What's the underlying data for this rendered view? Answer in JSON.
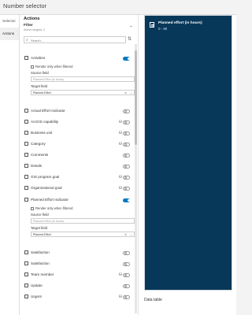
{
  "app_title": "Number selector",
  "left_tabs": [
    "Selector",
    "Actions"
  ],
  "settings": {
    "header": "Actions",
    "filter_title": "Filter",
    "filter_subtitle": "Active targets: 2",
    "search_placeholder": "Search..."
  },
  "fields": [
    {
      "label": "Activities",
      "icon": "table-icon",
      "db": false,
      "on": true
    },
    {
      "label": "Actual Effort Indicator",
      "icon": "table-icon",
      "db": false,
      "on": false
    },
    {
      "label": "ArcGIS capability",
      "icon": "table-icon",
      "db": true,
      "on": false
    },
    {
      "label": "Business unit",
      "icon": "table-icon",
      "db": true,
      "on": false
    },
    {
      "label": "Category",
      "icon": "table-icon",
      "db": true,
      "on": false
    },
    {
      "label": "Comments",
      "icon": "table-icon",
      "db": false,
      "on": false
    },
    {
      "label": "Details",
      "icon": "table-icon",
      "db": false,
      "on": false
    },
    {
      "label": "GIS program goal",
      "icon": "table-icon",
      "db": true,
      "on": false
    },
    {
      "label": "Organizational goal",
      "icon": "table-icon",
      "db": true,
      "on": false
    },
    {
      "label": "Planned Effort Indicator",
      "icon": "table-icon",
      "db": false,
      "on": true
    },
    {
      "label": "Satisfaction",
      "icon": "table-icon",
      "db": false,
      "on": false
    },
    {
      "label": "Satisfaction",
      "icon": "table-icon",
      "db": false,
      "on": false
    },
    {
      "label": "Team member",
      "icon": "table-icon",
      "db": true,
      "on": false
    },
    {
      "label": "Update",
      "icon": "table-icon",
      "db": false,
      "on": false
    },
    {
      "label": "Urgent",
      "icon": "table-icon",
      "db": true,
      "on": false
    }
  ],
  "expanded": {
    "render_label": "Render only when filtered",
    "source_label": "Source field",
    "source_placeholder": "Planned Effort (in hours)",
    "target_label": "Target field",
    "target_value_1": "Planned Effort",
    "target_value_2": "Planned Effort"
  },
  "widget": {
    "title": "Planned effort (in hours)",
    "range": "0 - 80",
    "bg_color": "#083859"
  },
  "data_table_label": "Data table",
  "accent_color": "#007ac2"
}
